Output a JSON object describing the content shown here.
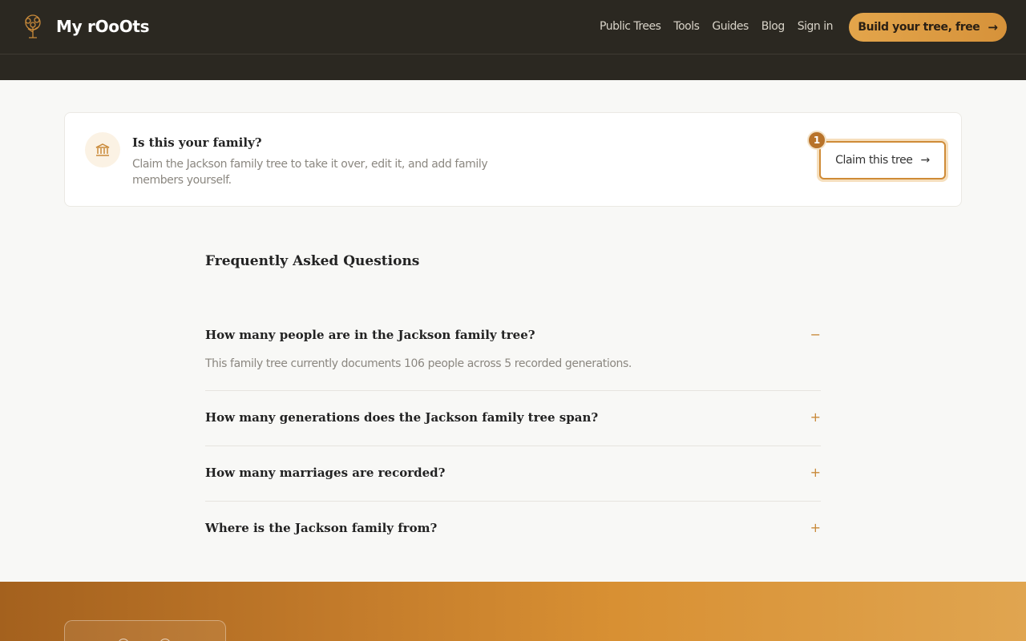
{
  "header": {
    "logo_text": "My rOoOts",
    "nav": [
      "Public Trees",
      "Tools",
      "Guides",
      "Blog",
      "Sign in"
    ],
    "cta_label": "Build your tree, free",
    "cta_arrow": "→"
  },
  "claim": {
    "title": "Is this your family?",
    "description": "Claim the Jackson family tree to take it over, edit it, and add family members yourself.",
    "button_label": "Claim this tree",
    "button_arrow": "→",
    "step_number": "1"
  },
  "faq": {
    "heading": "Frequently Asked Questions",
    "items": [
      {
        "question": "How many people are in the Jackson family tree?",
        "answer": "This family tree currently documents 106 people across 5 recorded generations.",
        "toggle": "−"
      },
      {
        "question": "How many generations does the Jackson family tree span?",
        "toggle": "+"
      },
      {
        "question": "How many marriages are recorded?",
        "toggle": "+"
      },
      {
        "question": "Where is the Jackson family from?",
        "toggle": "+"
      }
    ]
  },
  "icons": {
    "logo": "tree-icon",
    "claim": "institution-icon"
  },
  "colors": {
    "accent": "#cf8b37",
    "header_bg": "#2b2821"
  }
}
